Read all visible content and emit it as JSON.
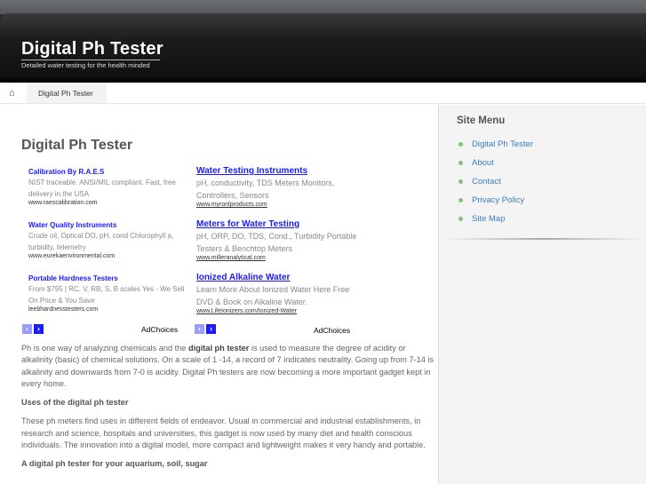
{
  "site": {
    "title": "Digital Ph Tester",
    "tagline": "Detailed water testing for the health minded"
  },
  "breadcrumb": {
    "home_icon": "home-icon",
    "current": "Digital Ph Tester"
  },
  "page_title": "Digital Ph Tester",
  "ads_left": [
    {
      "title": "Calibration By R.A.E.S",
      "desc": "NIST traceable. ANSI/MIL compliant. Fast, free delivery in the USA",
      "url": "www.raescalibration.com"
    },
    {
      "title": "Water Quality Instruments",
      "desc": "Crude oil, Optical DO, pH, cond Chlorophyll a, turbidity, telemetry",
      "url": "www.eurekaenvironmental.com"
    },
    {
      "title": "Portable Hardness Testers",
      "desc": "From $795 | RC, V, RB, S, B scales Yes - We Sell On Price & You Save",
      "url": "leebhardnesstesters.com"
    }
  ],
  "ads_right": [
    {
      "title": "Water Testing Instruments",
      "desc": "pH, conductivity, TDS Meters Monitors, Controllers, Sensors",
      "url": "www.myronlproducts.com"
    },
    {
      "title": "Meters for Water Testing",
      "desc": "pH, ORP, DO, TDS, Cond., Turbidity Portable Testers & Benchtop Meters",
      "url": "www.milleranalytical.com"
    },
    {
      "title": "Ionized Alkaline Water",
      "desc": "Learn More About Ionized Water Here Free DVD & Book on Alkaline Water.",
      "url": "www.LifeIonizers.com/Ionized-Water"
    }
  ],
  "adchoices": "AdChoices",
  "article": {
    "p1_a": "Ph is one way of analyzing chemicals and the ",
    "p1_bold": "digital ph tester",
    "p1_b": " is used to measure the degree of acidity or alkalinity (basic) of chemical solutions. On a scale of 1 -14, a record of 7 indicates neutrality. Going up from 7-14 is alkalinity and downwards from 7-0 is acidity. Digital Ph testers are now becoming a more important gadget kept in every home.",
    "h2": "Uses of the digital ph tester",
    "p2": "These ph meters find uses in different fields of endeavor.  Usual in commercial and industrial establishments, in research and science, hospitals and universities, this gadget is now used by many diet and health conscious individuals. The innovation into a digital model, more compact and lightweight makes it very handy and portable.",
    "h3": "A digital ph tester for your aquarium, soil, sugar"
  },
  "sidebar": {
    "title": "Site Menu",
    "items": [
      "Digital Ph Tester",
      "About",
      "Contact",
      "Privacy Policy",
      "Site Map"
    ]
  }
}
